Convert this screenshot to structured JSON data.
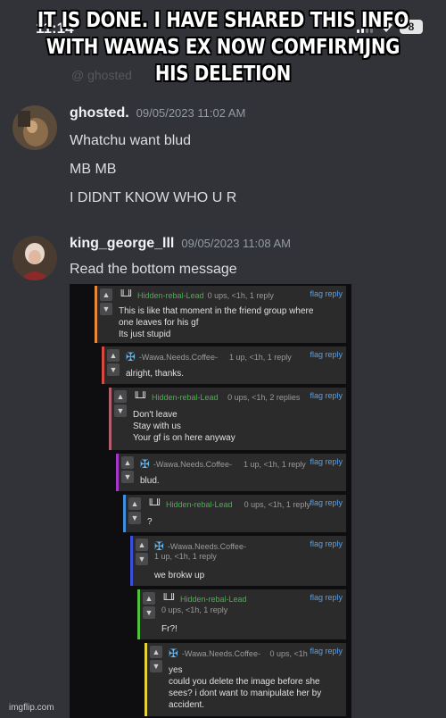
{
  "status_bar": {
    "time": "11:14",
    "battery": "8"
  },
  "caption": "IT IS DONE. I HAVE SHARED THIS INFO WITH WAWAS EX NOW COMFIRMJNG HIS DELETION",
  "faded_header": "@ ghosted",
  "messages": [
    {
      "username": "ghosted.",
      "timestamp": "09/05/2023 11:02 AM",
      "lines": [
        "Whatchu want blud",
        "MB MB",
        "I DIDNT KNOW WHO U R"
      ]
    },
    {
      "username": "king_george_lll",
      "timestamp": "09/05/2023 11:08 AM",
      "lines": [
        "Read the bottom message"
      ]
    }
  ],
  "comments": [
    {
      "author": "Hidden-rebal-Lead",
      "meta": "0 ups, <1h, 1 reply",
      "color": "#e8893a",
      "lines": [
        "This is like that moment in the friend group where",
        "one leaves for his gf",
        "Its just stupid"
      ]
    },
    {
      "author": "-Wawa.Needs.Coffee-",
      "meta": "1 up, <1h, 1 reply",
      "color": "#d64a3f",
      "lines": [
        "alright, thanks."
      ]
    },
    {
      "author": "Hidden-rebal-Lead",
      "meta": "0 ups, <1h, 2 replies",
      "color": "#b2606e",
      "lines": [
        "Don't leave",
        "Stay with us",
        "Your gf is on here anyway"
      ]
    },
    {
      "author": "-Wawa.Needs.Coffee-",
      "meta": "1 up, <1h, 1 reply",
      "color": "#a437c6",
      "lines": [
        "blud."
      ]
    },
    {
      "author": "Hidden-rebal-Lead",
      "meta": "0 ups, <1h, 1 reply",
      "color": "#3e8fe0",
      "lines": [
        "?"
      ]
    },
    {
      "author": "-Wawa.Needs.Coffee-",
      "meta": "1 up, <1h, 1 reply",
      "color": "#3b4fd8",
      "lines": [
        "we brokw up"
      ]
    },
    {
      "author": "Hidden-rebal-Lead",
      "meta": "0 ups, <1h, 1 reply",
      "color": "#52c23a",
      "lines": [
        "Fr?!"
      ]
    },
    {
      "author": "-Wawa.Needs.Coffee-",
      "meta": "0 ups, <1h",
      "color": "#e3d43a",
      "lines": [
        "yes",
        "could you delete the image before she",
        "sees? i dont want to manipulate her by",
        "accident."
      ]
    }
  ],
  "actions": {
    "flag": "flag",
    "reply": "reply"
  },
  "vote_icons": {
    "up": "▲",
    "down": "▼"
  },
  "emblems": {
    "rebal": "╙╜",
    "wawa": "✠"
  },
  "watermark": "imgflip.com"
}
